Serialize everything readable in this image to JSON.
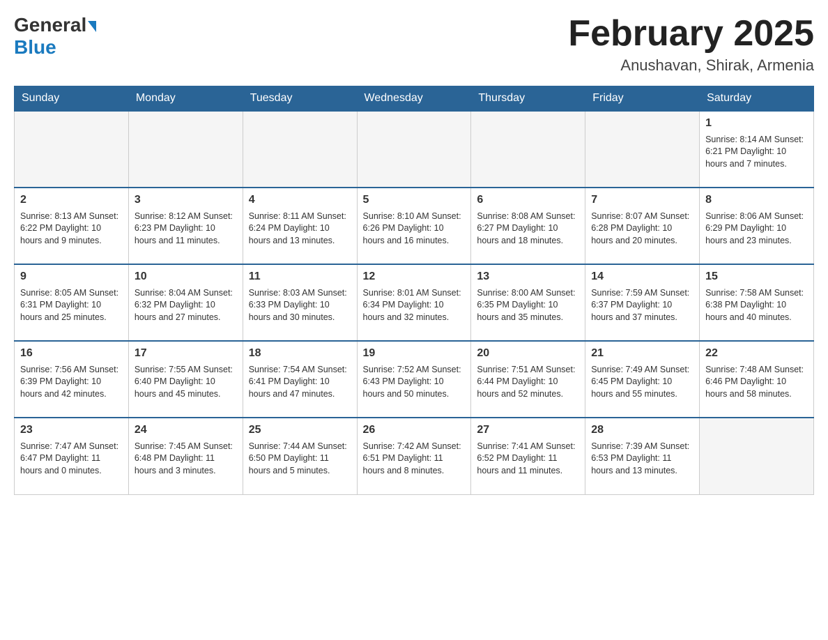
{
  "logo": {
    "general": "General",
    "blue": "Blue"
  },
  "title": "February 2025",
  "location": "Anushavan, Shirak, Armenia",
  "weekdays": [
    "Sunday",
    "Monday",
    "Tuesday",
    "Wednesday",
    "Thursday",
    "Friday",
    "Saturday"
  ],
  "weeks": [
    [
      {
        "day": "",
        "info": ""
      },
      {
        "day": "",
        "info": ""
      },
      {
        "day": "",
        "info": ""
      },
      {
        "day": "",
        "info": ""
      },
      {
        "day": "",
        "info": ""
      },
      {
        "day": "",
        "info": ""
      },
      {
        "day": "1",
        "info": "Sunrise: 8:14 AM\nSunset: 6:21 PM\nDaylight: 10 hours and 7 minutes."
      }
    ],
    [
      {
        "day": "2",
        "info": "Sunrise: 8:13 AM\nSunset: 6:22 PM\nDaylight: 10 hours and 9 minutes."
      },
      {
        "day": "3",
        "info": "Sunrise: 8:12 AM\nSunset: 6:23 PM\nDaylight: 10 hours and 11 minutes."
      },
      {
        "day": "4",
        "info": "Sunrise: 8:11 AM\nSunset: 6:24 PM\nDaylight: 10 hours and 13 minutes."
      },
      {
        "day": "5",
        "info": "Sunrise: 8:10 AM\nSunset: 6:26 PM\nDaylight: 10 hours and 16 minutes."
      },
      {
        "day": "6",
        "info": "Sunrise: 8:08 AM\nSunset: 6:27 PM\nDaylight: 10 hours and 18 minutes."
      },
      {
        "day": "7",
        "info": "Sunrise: 8:07 AM\nSunset: 6:28 PM\nDaylight: 10 hours and 20 minutes."
      },
      {
        "day": "8",
        "info": "Sunrise: 8:06 AM\nSunset: 6:29 PM\nDaylight: 10 hours and 23 minutes."
      }
    ],
    [
      {
        "day": "9",
        "info": "Sunrise: 8:05 AM\nSunset: 6:31 PM\nDaylight: 10 hours and 25 minutes."
      },
      {
        "day": "10",
        "info": "Sunrise: 8:04 AM\nSunset: 6:32 PM\nDaylight: 10 hours and 27 minutes."
      },
      {
        "day": "11",
        "info": "Sunrise: 8:03 AM\nSunset: 6:33 PM\nDaylight: 10 hours and 30 minutes."
      },
      {
        "day": "12",
        "info": "Sunrise: 8:01 AM\nSunset: 6:34 PM\nDaylight: 10 hours and 32 minutes."
      },
      {
        "day": "13",
        "info": "Sunrise: 8:00 AM\nSunset: 6:35 PM\nDaylight: 10 hours and 35 minutes."
      },
      {
        "day": "14",
        "info": "Sunrise: 7:59 AM\nSunset: 6:37 PM\nDaylight: 10 hours and 37 minutes."
      },
      {
        "day": "15",
        "info": "Sunrise: 7:58 AM\nSunset: 6:38 PM\nDaylight: 10 hours and 40 minutes."
      }
    ],
    [
      {
        "day": "16",
        "info": "Sunrise: 7:56 AM\nSunset: 6:39 PM\nDaylight: 10 hours and 42 minutes."
      },
      {
        "day": "17",
        "info": "Sunrise: 7:55 AM\nSunset: 6:40 PM\nDaylight: 10 hours and 45 minutes."
      },
      {
        "day": "18",
        "info": "Sunrise: 7:54 AM\nSunset: 6:41 PM\nDaylight: 10 hours and 47 minutes."
      },
      {
        "day": "19",
        "info": "Sunrise: 7:52 AM\nSunset: 6:43 PM\nDaylight: 10 hours and 50 minutes."
      },
      {
        "day": "20",
        "info": "Sunrise: 7:51 AM\nSunset: 6:44 PM\nDaylight: 10 hours and 52 minutes."
      },
      {
        "day": "21",
        "info": "Sunrise: 7:49 AM\nSunset: 6:45 PM\nDaylight: 10 hours and 55 minutes."
      },
      {
        "day": "22",
        "info": "Sunrise: 7:48 AM\nSunset: 6:46 PM\nDaylight: 10 hours and 58 minutes."
      }
    ],
    [
      {
        "day": "23",
        "info": "Sunrise: 7:47 AM\nSunset: 6:47 PM\nDaylight: 11 hours and 0 minutes."
      },
      {
        "day": "24",
        "info": "Sunrise: 7:45 AM\nSunset: 6:48 PM\nDaylight: 11 hours and 3 minutes."
      },
      {
        "day": "25",
        "info": "Sunrise: 7:44 AM\nSunset: 6:50 PM\nDaylight: 11 hours and 5 minutes."
      },
      {
        "day": "26",
        "info": "Sunrise: 7:42 AM\nSunset: 6:51 PM\nDaylight: 11 hours and 8 minutes."
      },
      {
        "day": "27",
        "info": "Sunrise: 7:41 AM\nSunset: 6:52 PM\nDaylight: 11 hours and 11 minutes."
      },
      {
        "day": "28",
        "info": "Sunrise: 7:39 AM\nSunset: 6:53 PM\nDaylight: 11 hours and 13 minutes."
      },
      {
        "day": "",
        "info": ""
      }
    ]
  ]
}
